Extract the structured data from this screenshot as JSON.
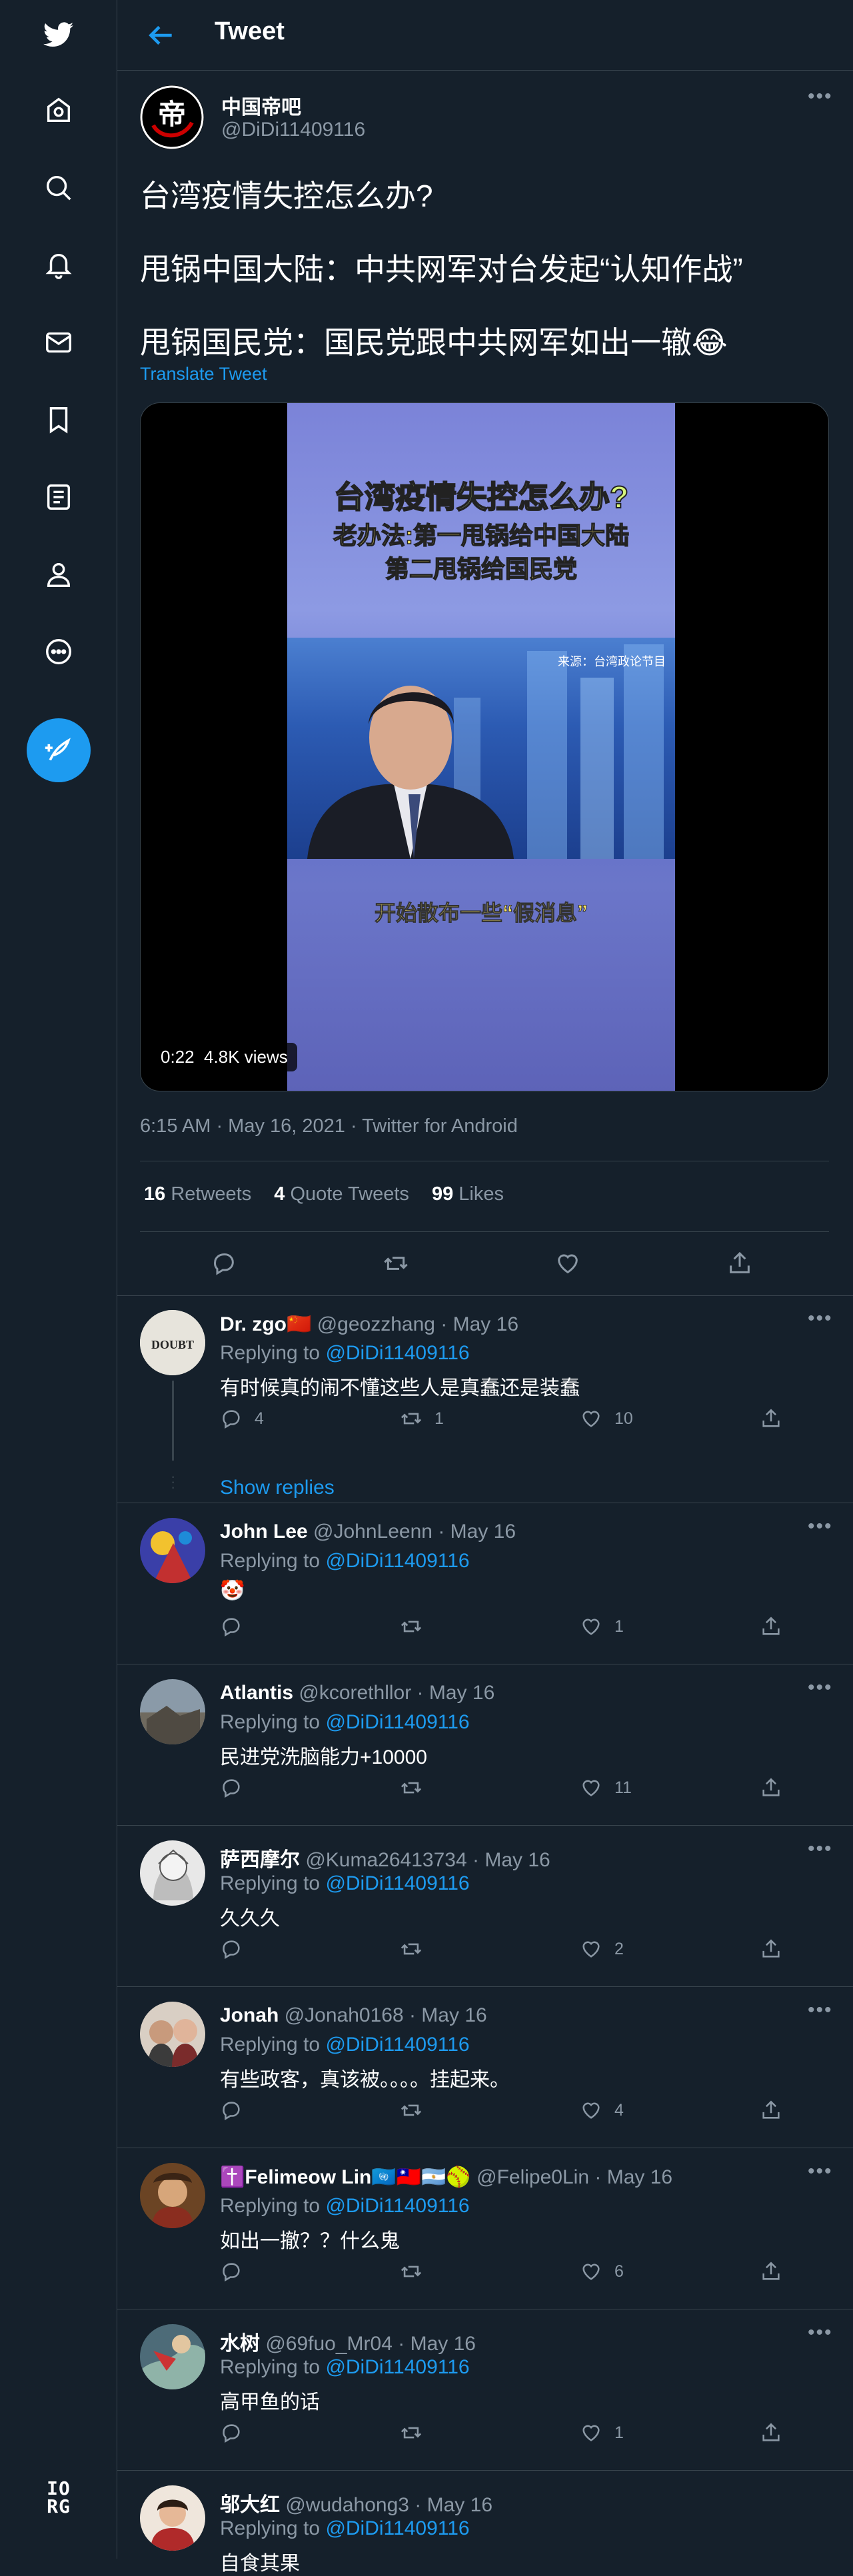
{
  "header": {
    "title": "Tweet"
  },
  "tweet": {
    "author_name": "中国帝吧",
    "author_handle": "@DiDi11409116",
    "lines": [
      "台湾疫情失控怎么办?",
      "甩锅中国大陆：中共网军对台发起“认知作战”",
      "甩锅国民党：国民党跟中共网军如出一辙😂"
    ],
    "translate": "Translate Tweet",
    "video": {
      "title1": "台湾疫情失控怎么办?",
      "title2": "老办法:第一甩锅给中国大陆",
      "title3": "第二甩锅给国民党",
      "source": "来源：台湾政论节目",
      "caption": "开始散布一些“假消息”",
      "badge": "0:22  4.8K views"
    },
    "meta": "6:15 AM · May 16, 2021 · Twitter for Android",
    "stats": {
      "retweets_count": "16",
      "retweets_label": "Retweets",
      "quotes_count": "4",
      "quotes_label": "Quote Tweets",
      "likes_count": "99",
      "likes_label": "Likes"
    }
  },
  "replies": [
    {
      "name": "Dr. zgo🇨🇳",
      "handle": "@geozzhang",
      "date": "· May 16",
      "replying": "Replying to",
      "to": "@DiDi11409116",
      "text": "有时候真的闹不懂这些人是真蠢还是装蠢",
      "replies": "4",
      "retweets": "1",
      "likes": "10",
      "show_replies": "Show replies",
      "avatar_text": "DOUBT"
    },
    {
      "name": "John Lee",
      "handle": "@JohnLeenn",
      "date": "· May 16",
      "replying": "Replying to",
      "to": "@DiDi11409116",
      "text": "🤡",
      "replies": "",
      "retweets": "",
      "likes": "1"
    },
    {
      "name": "Atlantis",
      "handle": "@kcorethllor",
      "date": "· May 16",
      "replying": "Replying to",
      "to": "@DiDi11409116",
      "text": "民进党洗脑能力+10000",
      "replies": "",
      "retweets": "",
      "likes": "11"
    },
    {
      "name": "萨西摩尔",
      "handle": "@Kuma26413734",
      "date": "· May 16",
      "replying": "Replying to",
      "to": "@DiDi11409116",
      "text": "久久久",
      "replies": "",
      "retweets": "",
      "likes": "2"
    },
    {
      "name": "Jonah",
      "handle": "@Jonah0168",
      "date": "· May 16",
      "replying": "Replying to",
      "to": "@DiDi11409116",
      "text": "有些政客，真该被。。。。挂起来。",
      "replies": "",
      "retweets": "",
      "likes": "4"
    },
    {
      "name": "✝️Felimeow Lin🇺🇳🇹🇼🇦🇷🥎",
      "handle": "@Felipe0Lin",
      "date": "· May 16",
      "replying": "Replying to",
      "to": "@DiDi11409116",
      "text": "如出一撤？？什么鬼",
      "replies": "",
      "retweets": "",
      "likes": "6"
    },
    {
      "name": "水树",
      "handle": "@69fuo_Mr04",
      "date": "· May 16",
      "replying": "Replying to",
      "to": "@DiDi11409116",
      "text": "高甲鱼的话",
      "replies": "",
      "retweets": "",
      "likes": "1"
    },
    {
      "name": "邬大红",
      "handle": "@wudahong3",
      "date": "· May 16",
      "replying": "Replying to",
      "to": "@DiDi11409116",
      "text": "自食其果",
      "replies": "",
      "retweets": "",
      "likes": ""
    }
  ],
  "logo_text": "IO\nRG",
  "colors": {
    "accent": "#1d9bf0",
    "background": "#15202b",
    "muted": "#8b98a5",
    "border": "#38444d"
  },
  "icons": [
    "twitter-logo-icon",
    "home-icon",
    "explore-icon",
    "notifications-icon",
    "messages-icon",
    "bookmarks-icon",
    "lists-icon",
    "profile-icon",
    "more-icon",
    "compose-icon",
    "back-arrow-icon",
    "reply-icon",
    "retweet-icon",
    "like-icon",
    "share-icon"
  ]
}
